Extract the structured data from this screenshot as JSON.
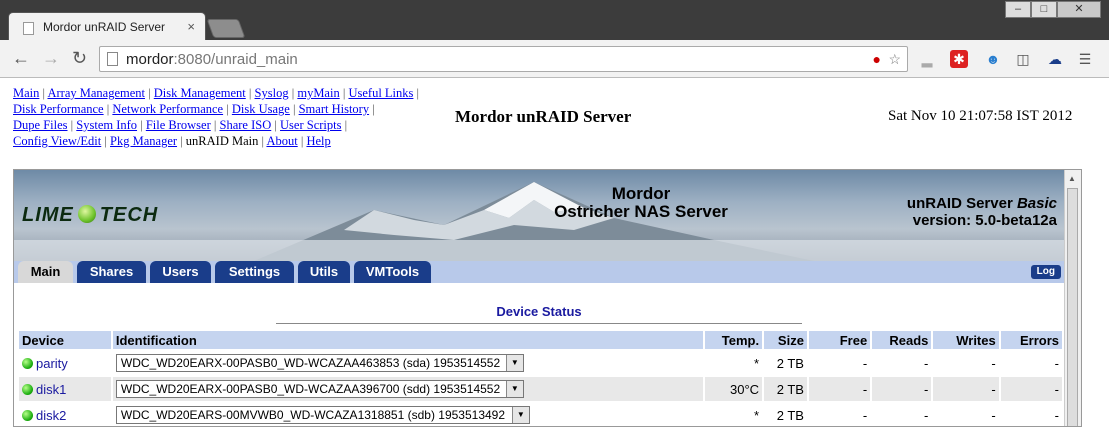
{
  "browser": {
    "tab_title": "Mordor unRAID Server",
    "tab_close": "×",
    "url_host": "mordor",
    "url_rest": ":8080/unraid_main",
    "window_buttons": [
      "–",
      "□",
      "✕"
    ]
  },
  "nav_links": [
    {
      "label": "Main",
      "link": true
    },
    {
      "label": "Array Management",
      "link": true
    },
    {
      "label": "Disk Management",
      "link": true
    },
    {
      "label": "Syslog",
      "link": true
    },
    {
      "label": "myMain",
      "link": true
    },
    {
      "label": "Useful Links",
      "link": true
    },
    {
      "label": "Disk Performance",
      "link": true
    },
    {
      "label": "Network Performance",
      "link": true
    },
    {
      "label": "Disk Usage",
      "link": true
    },
    {
      "label": "Smart History",
      "link": true
    },
    {
      "label": "Dupe Files",
      "link": true
    },
    {
      "label": "System Info",
      "link": true
    },
    {
      "label": "File Browser",
      "link": true
    },
    {
      "label": "Share ISO",
      "link": true
    },
    {
      "label": "User Scripts",
      "link": true
    },
    {
      "label": "Config View/Edit",
      "link": true
    },
    {
      "label": "Pkg Manager",
      "link": true
    },
    {
      "label": "unRAID Main",
      "link": false
    },
    {
      "label": "About",
      "link": true
    },
    {
      "label": "Help",
      "link": true
    }
  ],
  "header": {
    "server_title": "Mordor unRAID Server",
    "datetime": "Sat Nov 10 21:07:58 IST 2012"
  },
  "banner": {
    "logo_left": "LIME",
    "logo_right": "TECH",
    "name_line1": "Mordor",
    "name_line2": "Ostricher NAS Server",
    "version_line1": "unRAID Server",
    "version_edition": "Basic",
    "version_line2": "version: 5.0-beta12a"
  },
  "tabs": [
    {
      "label": "Main",
      "active": true
    },
    {
      "label": "Shares",
      "active": false
    },
    {
      "label": "Users",
      "active": false
    },
    {
      "label": "Settings",
      "active": false
    },
    {
      "label": "Utils",
      "active": false
    },
    {
      "label": "VMTools",
      "active": false
    }
  ],
  "log_button": "Log",
  "device_status": {
    "title": "Device Status",
    "columns": [
      "Device",
      "Identification",
      "Temp.",
      "Size",
      "Free",
      "Reads",
      "Writes",
      "Errors"
    ],
    "rows": [
      {
        "device": "parity",
        "identification": "WDC_WD20EARX-00PASB0_WD-WCAZAA463853 (sda) 1953514552",
        "temp": "*",
        "size": "2 TB",
        "free": "-",
        "reads": "-",
        "writes": "-",
        "errors": "-",
        "status_color": "#1cae10"
      },
      {
        "device": "disk1",
        "identification": "WDC_WD20EARX-00PASB0_WD-WCAZAA396700 (sdd) 1953514552",
        "temp": "30°C",
        "size": "2 TB",
        "free": "-",
        "reads": "-",
        "writes": "-",
        "errors": "-",
        "status_color": "#1cae10"
      },
      {
        "device": "disk2",
        "identification": "WDC_WD20EARS-00MVWB0_WD-WCAZA1318851 (sdb) 1953513492",
        "temp": "*",
        "size": "2 TB",
        "free": "-",
        "reads": "-",
        "writes": "-",
        "errors": "-",
        "status_color": "#1cae10"
      }
    ]
  }
}
